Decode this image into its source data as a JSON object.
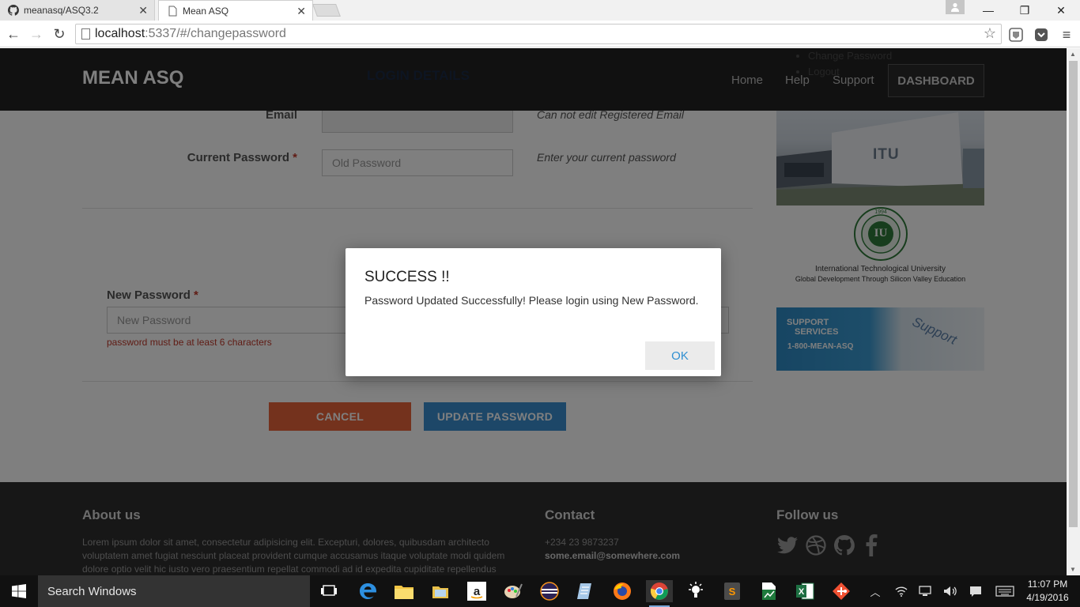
{
  "browser": {
    "tabs": [
      {
        "title": "meanasq/ASQ3.2",
        "active": false
      },
      {
        "title": "Mean ASQ",
        "active": true
      }
    ],
    "url_host": "localhost",
    "url_path": ":5337/#/changepassword"
  },
  "header": {
    "brand": "MEAN ASQ",
    "ghost_title": "LOGIN DETAILS",
    "dropdown_items": [
      "Change Password",
      "Logout"
    ],
    "nav": [
      "Home",
      "Help",
      "Support"
    ],
    "dashboard": "DASHBOARD"
  },
  "form": {
    "email_label": "Email",
    "email_help": "Can not edit Registered Email",
    "current_label": "Current Password",
    "current_placeholder": "Old Password",
    "current_help": "Enter your current password",
    "required_mark": "*",
    "new_label": "New Password",
    "new_placeholder": "New Password",
    "new_error": "password must be at least 6 characters",
    "cancel": "CANCEL",
    "update": "UPDATE PASSWORD"
  },
  "sidebar": {
    "campus_sign": "ITU",
    "seal_year": "1994",
    "seal_monogram": "IU",
    "university_name": "International Technological University",
    "university_tagline": "Global Development Through Silicon Valley Education",
    "support_title_line1": "SUPPORT",
    "support_title_line2": "SERVICES",
    "support_phone": "1-800-MEAN-ASQ",
    "support_key": "Support"
  },
  "footer": {
    "about_title": "About us",
    "about_text": "Lorem ipsum dolor sit amet, consectetur adipisicing elit. Excepturi, dolores, quibusdam architecto voluptatem amet fugiat nesciunt placeat provident cumque accusamus itaque voluptate modi quidem dolore optio velit hic iusto vero praesentium repellat commodi ad id expedita cupiditate repellendus",
    "contact_title": "Contact",
    "contact_phone": "+234 23 9873237",
    "contact_email": "some.email@somewhere.com",
    "follow_title": "Follow us",
    "social_icons": [
      "twitter-icon",
      "dribbble-icon",
      "github-icon",
      "facebook-icon"
    ]
  },
  "modal": {
    "title": "SUCCESS !!",
    "message": "Password Updated Successfully! Please login using New Password.",
    "ok": "OK"
  },
  "taskbar": {
    "search_placeholder": "Search Windows",
    "time": "11:07 PM",
    "date": "4/19/2016"
  },
  "colors": {
    "header_bg": "#222222",
    "cancel_btn": "#e8643a",
    "update_btn": "#3a8fd1",
    "ok_text": "#2f8fd1",
    "error_text": "#c0392b"
  }
}
